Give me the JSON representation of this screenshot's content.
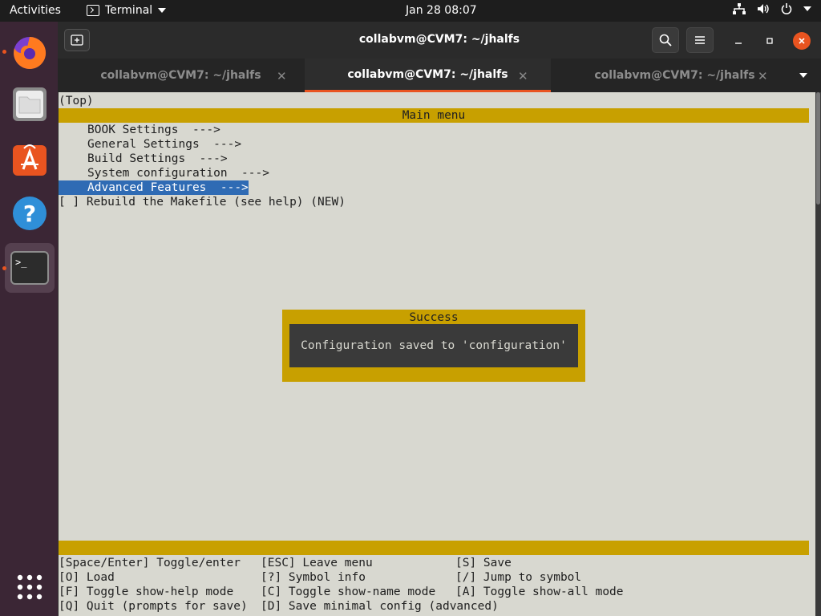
{
  "topbar": {
    "activities": "Activities",
    "app_name": "Terminal",
    "clock": "Jan 28  08:07"
  },
  "window": {
    "title": "collabvm@CVM7: ~/jhalfs",
    "tabs": [
      {
        "label": "collabvm@CVM7: ~/jhalfs",
        "active": false
      },
      {
        "label": "collabvm@CVM7: ~/jhalfs",
        "active": true
      },
      {
        "label": "collabvm@CVM7: ~/jhalfs",
        "active": false
      }
    ]
  },
  "terminal": {
    "breadcrumb": "(Top)",
    "menu_title": "Main menu",
    "items": [
      "BOOK Settings  --->",
      "General Settings  --->",
      "Build Settings  --->",
      "System configuration  --->",
      "Advanced Features  --->"
    ],
    "checkbox_item": "[ ] Rebuild the Makefile (see help) (NEW)",
    "dialog": {
      "title": "Success",
      "message": "Configuration saved to 'configuration'"
    },
    "help": [
      [
        "[Space/Enter] Toggle/enter",
        "[ESC] Leave menu",
        "[S] Save"
      ],
      [
        "[O] Load",
        "[?] Symbol info",
        "[/] Jump to symbol"
      ],
      [
        "[F] Toggle show-help mode",
        "[C] Toggle show-name mode",
        "[A] Toggle show-all mode"
      ],
      [
        "[Q] Quit (prompts for save)",
        "[D] Save minimal config (advanced)",
        ""
      ]
    ]
  },
  "colors": {
    "accent": "#e95420",
    "menu_bar": "#c8a000",
    "terminal_bg": "#d8d8d0",
    "selection": "#2f6bb4"
  }
}
